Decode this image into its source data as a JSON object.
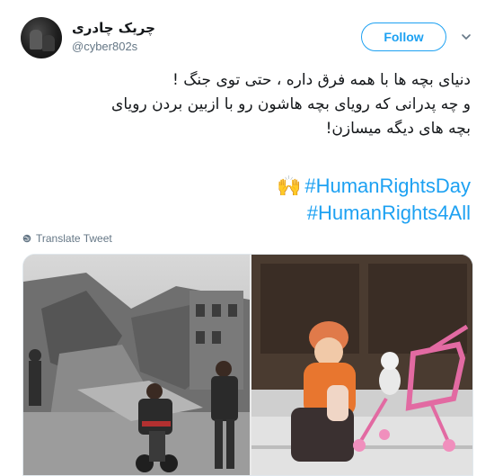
{
  "user": {
    "display_name": "چریک چادری",
    "handle": "@cyber802s"
  },
  "actions": {
    "follow_label": "Follow"
  },
  "tweet": {
    "lines": [
      "دنیای بچه ها با همه فرق داره ، حتی توی جنگ !",
      "و چه پدرانی که رویای بچه هاشون رو با ازبین بردن رویای",
      "بچه های دیگه میسازن!"
    ],
    "emoji": "🙌",
    "hashtags": [
      "#HumanRightsDay",
      "#HumanRights4All"
    ]
  },
  "translate_label": "Translate Tweet",
  "icons": {
    "menu": "chevron-down-icon",
    "translate": "globe-icon"
  },
  "colors": {
    "accent": "#1da1f2",
    "secondary_text": "#657786",
    "primary_text": "#14171a"
  }
}
